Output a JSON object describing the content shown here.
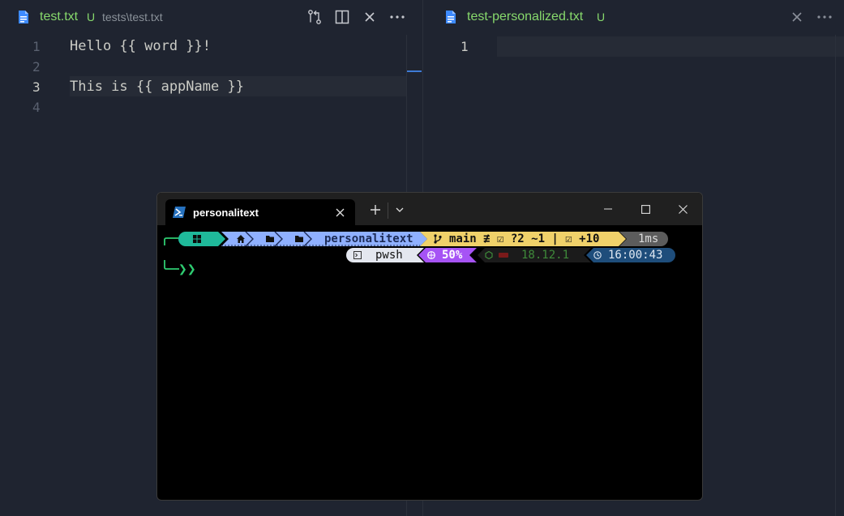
{
  "colors": {
    "editor_bg": "#1f2430",
    "accent_green": "#87d96c",
    "file_icon_blue": "#3e8bff",
    "prompt_green": "#2ecc71"
  },
  "left_editor": {
    "tab": {
      "icon": "file-icon",
      "name": "test.txt",
      "badge": "U",
      "path": "tests\\test.txt"
    },
    "actions": [
      "open-changes-icon",
      "split-editor-icon",
      "close-icon",
      "more-actions-icon"
    ],
    "lines": [
      {
        "number": "1",
        "text": "Hello {{ word }}!"
      },
      {
        "number": "2",
        "text": ""
      },
      {
        "number": "3",
        "text": "This is {{ appName }}"
      },
      {
        "number": "4",
        "text": ""
      }
    ],
    "active_line": "3"
  },
  "right_editor": {
    "tab": {
      "icon": "file-icon",
      "name": "test-personalized.txt",
      "badge": "U"
    },
    "actions": [
      "close-icon",
      "more-actions-icon"
    ],
    "lines": [
      {
        "number": "1",
        "text": ""
      }
    ]
  },
  "terminal": {
    "tab_title": "personalitext",
    "tab_icon": "powershell-icon",
    "new_tab": "+",
    "prompt": {
      "os_icon": "windows-icon",
      "path_icons": [
        "home-icon",
        "folder-icon",
        "folder-icon"
      ],
      "folder": "personalitext",
      "git": "main ≢ ☑ ?2 ~1 | ☑ +10",
      "git_icon": "branch-icon",
      "exec_time": "1ms",
      "shell": "pwsh",
      "battery": "50%",
      "node_version": "18.12.1",
      "clock": "16:00:43",
      "caret": "❯❯"
    }
  }
}
